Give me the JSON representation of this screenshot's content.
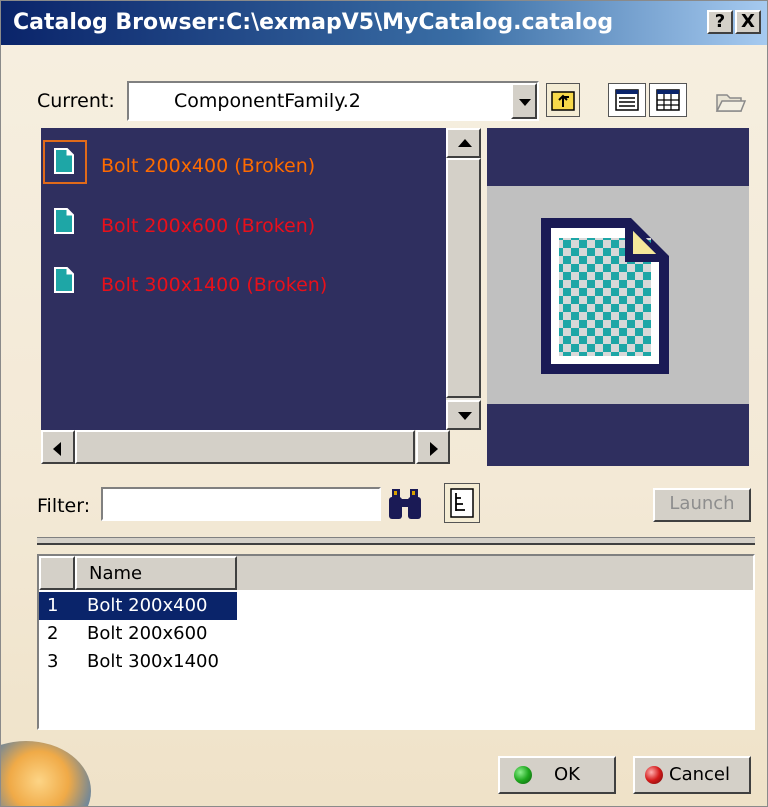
{
  "window": {
    "title": "Catalog Browser:C:\\exmapV5\\MyCatalog.catalog",
    "help_label": "?",
    "close_label": "X"
  },
  "current": {
    "label": "Current:",
    "value": "ComponentFamily.2"
  },
  "items": [
    {
      "label": "Bolt 200x400 (Broken)",
      "color": "#ff6a00",
      "focused": true
    },
    {
      "label": "Bolt 200x600 (Broken)",
      "color": "#e8101a",
      "focused": false
    },
    {
      "label": "Bolt 300x1400 (Broken)",
      "color": "#e8101a",
      "focused": false
    }
  ],
  "filter": {
    "label": "Filter:",
    "value": ""
  },
  "launch_label": "Launch",
  "table": {
    "column_name": "Name",
    "rows": [
      {
        "index": "1",
        "name": "Bolt 200x400",
        "selected": true
      },
      {
        "index": "2",
        "name": "Bolt 200x600",
        "selected": false
      },
      {
        "index": "3",
        "name": "Bolt 300x1400",
        "selected": false
      }
    ]
  },
  "buttons": {
    "ok_label": "OK",
    "cancel_label": "Cancel"
  },
  "colors": {
    "titlebar_start": "#0a246a",
    "panel_bg": "#2f2f5f",
    "selection": "#0a246a",
    "ok_icon": "#1fa81f",
    "cancel_icon": "#d41a1a"
  }
}
